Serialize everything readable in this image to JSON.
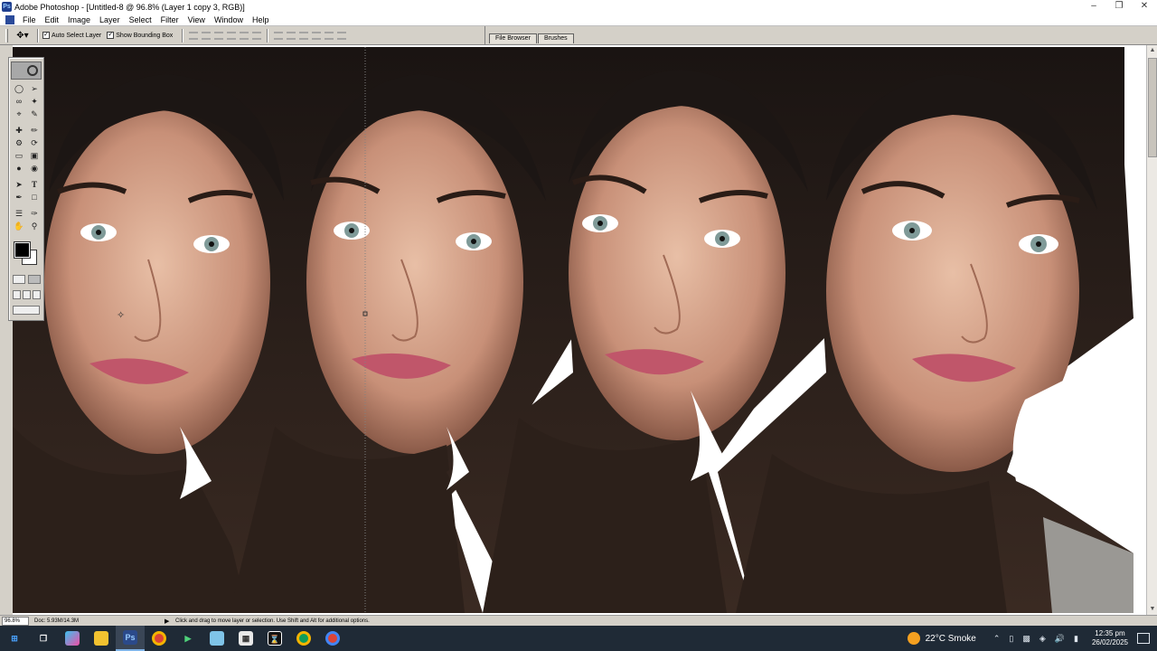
{
  "window": {
    "title": "Adobe Photoshop - [Untitled-8 @ 96.8% (Layer 1 copy 3, RGB)]",
    "app_icon": "photoshop-icon",
    "controls": [
      "minimize-icon",
      "maximize-icon",
      "close-icon"
    ]
  },
  "menu": {
    "items": [
      "File",
      "Edit",
      "Image",
      "Layer",
      "Select",
      "Filter",
      "View",
      "Window",
      "Help"
    ]
  },
  "options_bar": {
    "tool_preset_icon": "move-tool-icon",
    "auto_select_layer": {
      "label": "Auto Select Layer",
      "checked": true
    },
    "show_bounding_box": {
      "label": "Show Bounding Box",
      "checked": true
    }
  },
  "palette_well": {
    "tabs": [
      "File Browser",
      "Brushes"
    ]
  },
  "document": {
    "layer_name": "Layer 1 copy 3",
    "image_description_icon": "portrait-photo-icon"
  },
  "toolbox": {
    "tools": [
      "marquee-icon",
      "move-icon",
      "lasso-icon",
      "magic-wand-icon",
      "crop-icon",
      "slice-icon",
      "healing-brush-icon",
      "brush-icon",
      "clone-stamp-icon",
      "history-brush-icon",
      "eraser-icon",
      "gradient-icon",
      "blur-icon",
      "dodge-icon",
      "path-selection-icon",
      "type-icon",
      "pen-icon",
      "shape-icon",
      "notes-icon",
      "eyedropper-icon",
      "hand-icon",
      "zoom-icon"
    ],
    "type_label": "T",
    "foreground_color": "#000000",
    "background_color": "#ffffff"
  },
  "status_bar": {
    "zoom": "96.8%",
    "doc_info": "Doc: 5.93M/14.3M",
    "hint": "Click and drag to move layer or selection. Use Shift and Alt for additional options."
  },
  "taskbar": {
    "apps": [
      "windows-start-icon",
      "task-view-icon",
      "copilot-icon",
      "file-explorer-icon",
      "photoshop-icon",
      "chrome-icon",
      "media-player-icon",
      "notepad-icon",
      "calculator-icon",
      "capcut-icon",
      "chrome-icon",
      "chrome-icon"
    ],
    "weather": {
      "temp": "22°C",
      "condition": "Smoke"
    },
    "time": "12:35 pm",
    "date": "26/02/2025"
  }
}
